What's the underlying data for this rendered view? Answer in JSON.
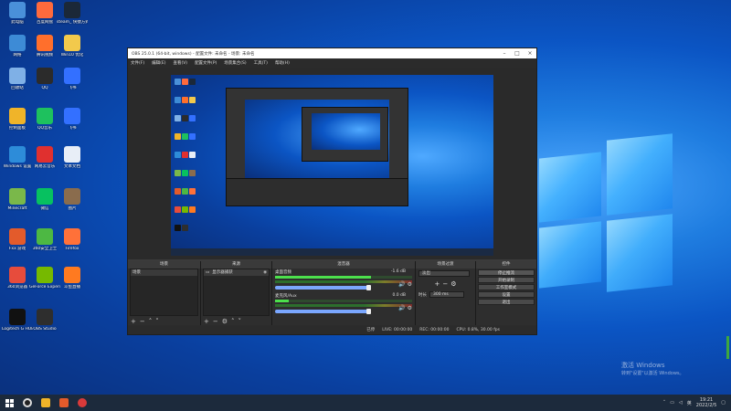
{
  "desktop_icons": [
    {
      "label": "此电脑",
      "color": "#4a90d9"
    },
    {
      "label": "百度网盘",
      "color": "#ff6a3d"
    },
    {
      "label": "steam_ 快捷方式",
      "color": "#1b2838"
    },
    {
      "label": "网络",
      "color": "#3d8bd6"
    },
    {
      "label": "腾讯视频",
      "color": "#ff6f2c"
    },
    {
      "label": "Win10 优化",
      "color": "#f2c94c"
    },
    {
      "label": "回收站",
      "color": "#7fb0e6"
    },
    {
      "label": "QQ",
      "color": "#2b2b2b"
    },
    {
      "label": "飞书",
      "color": "#3370ff"
    },
    {
      "label": "控制面板",
      "color": "#f0b429"
    },
    {
      "label": "QQ音乐",
      "color": "#1ec15e"
    },
    {
      "label": "飞书",
      "color": "#3370ff"
    },
    {
      "label": "Windows 设置",
      "color": "#2d8cd9"
    },
    {
      "label": "网易云音乐",
      "color": "#e0302f"
    },
    {
      "label": "文本文档",
      "color": "#e8eef7"
    },
    {
      "label": "Minecraft",
      "color": "#7ab84a"
    },
    {
      "label": "微信",
      "color": "#07c160"
    },
    {
      "label": "图片",
      "color": "#8a6c4d"
    },
    {
      "label": "Fxx 游戏",
      "color": "#e35b2b"
    },
    {
      "label": "360安全卫士",
      "color": "#4db843"
    },
    {
      "label": "Firefox",
      "color": "#ff7139"
    },
    {
      "label": "360浏览器",
      "color": "#e74c3c"
    },
    {
      "label": "GeForce Experience",
      "color": "#76b900"
    },
    {
      "label": "斗鱼直播",
      "color": "#ff7a20"
    },
    {
      "label": "Logitech G HUB",
      "color": "#111111"
    },
    {
      "label": "OBS Studio",
      "color": "#2e2e2e"
    }
  ],
  "obs": {
    "title": "OBS 25.0.1 (64-bit, windows) - 配置文件: 未命名 - 场景: 未命名",
    "menu": [
      "文件(F)",
      "编辑(E)",
      "查看(V)",
      "配置文件(P)",
      "场景集合(S)",
      "工具(T)",
      "帮助(H)"
    ],
    "docks": {
      "scenes": {
        "title": "场景",
        "items": [
          "场景"
        ]
      },
      "sources": {
        "title": "来源",
        "items": [
          "显示器捕获"
        ]
      },
      "mixer": {
        "title": "混音器",
        "tracks": [
          {
            "name": "桌面音频",
            "db": "-1.6 dB"
          },
          {
            "name": "麦克风/Aux",
            "db": "0.0 dB"
          }
        ]
      },
      "transitions": {
        "title": "场景过渡",
        "type": "淡出",
        "duration_label": "时长",
        "duration": "300 ms"
      },
      "controls": {
        "title": "控件",
        "buttons": [
          "停止推流",
          "开始录制",
          "工作室模式",
          "设置",
          "退出"
        ]
      }
    },
    "status": {
      "live": "LIVE: 00:00:00",
      "rec": "REC: 00:00:00",
      "cpu": "CPU: 0.8%, 30.00 fps",
      "prefix": "已停"
    }
  },
  "watermark": {
    "line1": "激活 Windows",
    "line2": "转到\"设置\"以激活 Windows。"
  },
  "taskbar": {
    "lang": "英",
    "time": "19:21",
    "date": "2022/2/5"
  }
}
